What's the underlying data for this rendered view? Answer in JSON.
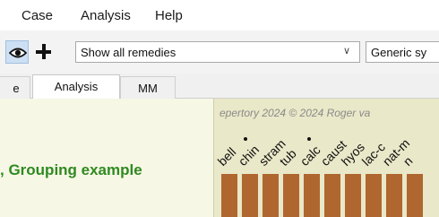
{
  "menu": {
    "case": "Case",
    "analysis": "Analysis",
    "help": "Help"
  },
  "toolbar": {
    "remedy_filter": "Show all remedies",
    "symptom_filter": "Generic sy"
  },
  "tabs": {
    "partial": "e",
    "analysis": "Analysis",
    "mm": "MM"
  },
  "content": {
    "title": ", Grouping example",
    "copyright": "epertory 2024 © 2024 Roger va"
  },
  "remedies": [
    "bell",
    "chin",
    "stram",
    "tub",
    "calc",
    "caust",
    "hyos",
    "lac-c",
    "nat-m",
    "n"
  ],
  "colors": {
    "bar": "#b0662f",
    "title": "#2f8a1f",
    "left_bg": "#f7f7e6",
    "right_bg": "#e9e8c8"
  }
}
